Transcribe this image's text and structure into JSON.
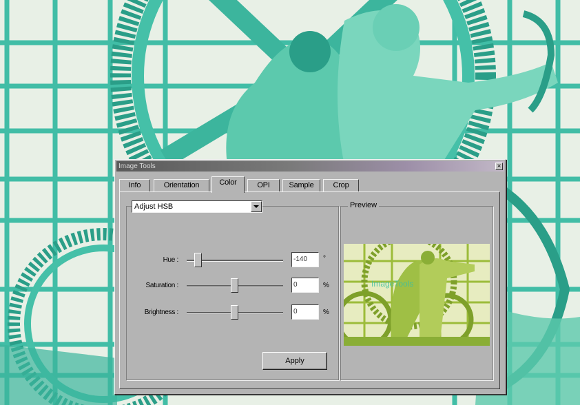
{
  "window": {
    "title": "Image Tools",
    "close_glyph": "×"
  },
  "tabs": [
    {
      "label": "Info"
    },
    {
      "label": "Orientation"
    },
    {
      "label": "Color",
      "active": true
    },
    {
      "label": "OPI"
    },
    {
      "label": "Sample"
    },
    {
      "label": "Crop"
    }
  ],
  "adjust": {
    "mode": "Adjust HSB"
  },
  "controls": {
    "hue": {
      "label": "Hue :",
      "value": "-140",
      "unit": "°",
      "level": 0.11
    },
    "saturation": {
      "label": "Saturation :",
      "value": "0",
      "unit": "%",
      "level": 0.5
    },
    "brightness": {
      "label": "Brightness :",
      "value": "0",
      "unit": "%",
      "level": 0.5
    }
  },
  "apply_label": "Apply",
  "preview": {
    "caption": "Preview"
  },
  "colors": {
    "background_art": "#2fb8a0",
    "preview_tint": "#8ab030"
  }
}
